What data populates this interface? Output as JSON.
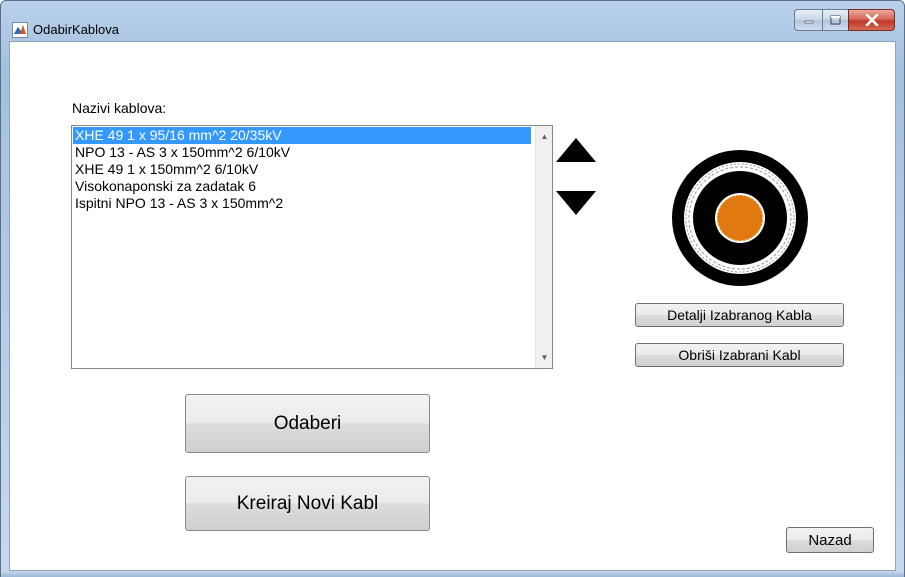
{
  "window": {
    "title": "OdabirKablova",
    "icon": "matlab-icon",
    "controls": [
      "minimize-icon",
      "maximize-icon",
      "close-icon"
    ]
  },
  "list": {
    "label": "Nazivi kablova:",
    "items": [
      "XHE 49 1 x 95/16 mm^2 20/35kV",
      "NPO 13 - AS 3 x 150mm^2 6/10kV",
      "XHE 49 1 x 150mm^2 6/10kV",
      "Visokonaponski za zadatak 6",
      "Ispitni NPO 13 - AS 3 x 150mm^2"
    ],
    "selected_index": 0,
    "scroll_up_icon": "scroll-up-icon",
    "scroll_down_icon": "scroll-down-icon"
  },
  "reorder": {
    "up_icon": "triangle-up-icon",
    "down_icon": "triangle-down-icon"
  },
  "cable_preview": {
    "icon": "cable-cross-section-icon",
    "colors": {
      "outer_sheath": "#000000",
      "screen": "#ffffff",
      "insulation": "#000000",
      "conductor": "#e07a10"
    }
  },
  "buttons": {
    "detalji": "Detalji Izabranog Kabla",
    "obrisi": "Obriši Izabrani Kabl",
    "odaberi": "Odaberi",
    "kreiraj": "Kreiraj Novi Kabl",
    "nazad": "Nazad"
  },
  "colors": {
    "selection": "#3399ff",
    "window_frame": "#b9d1ea",
    "close_button": "#c0392b"
  }
}
